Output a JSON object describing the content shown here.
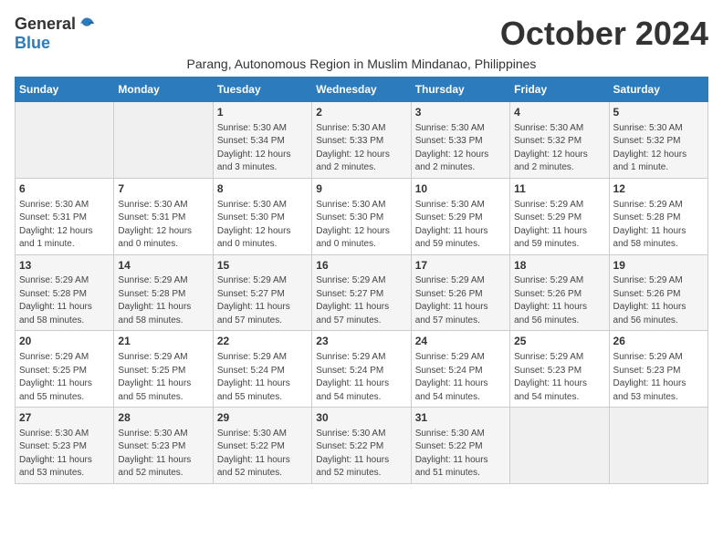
{
  "logo": {
    "general": "General",
    "blue": "Blue"
  },
  "header": {
    "month": "October 2024",
    "subtitle": "Parang, Autonomous Region in Muslim Mindanao, Philippines"
  },
  "weekdays": [
    "Sunday",
    "Monday",
    "Tuesday",
    "Wednesday",
    "Thursday",
    "Friday",
    "Saturday"
  ],
  "weeks": [
    [
      {
        "day": "",
        "info": ""
      },
      {
        "day": "",
        "info": ""
      },
      {
        "day": "1",
        "info": "Sunrise: 5:30 AM\nSunset: 5:34 PM\nDaylight: 12 hours\nand 3 minutes."
      },
      {
        "day": "2",
        "info": "Sunrise: 5:30 AM\nSunset: 5:33 PM\nDaylight: 12 hours\nand 2 minutes."
      },
      {
        "day": "3",
        "info": "Sunrise: 5:30 AM\nSunset: 5:33 PM\nDaylight: 12 hours\nand 2 minutes."
      },
      {
        "day": "4",
        "info": "Sunrise: 5:30 AM\nSunset: 5:32 PM\nDaylight: 12 hours\nand 2 minutes."
      },
      {
        "day": "5",
        "info": "Sunrise: 5:30 AM\nSunset: 5:32 PM\nDaylight: 12 hours\nand 1 minute."
      }
    ],
    [
      {
        "day": "6",
        "info": "Sunrise: 5:30 AM\nSunset: 5:31 PM\nDaylight: 12 hours\nand 1 minute."
      },
      {
        "day": "7",
        "info": "Sunrise: 5:30 AM\nSunset: 5:31 PM\nDaylight: 12 hours\nand 0 minutes."
      },
      {
        "day": "8",
        "info": "Sunrise: 5:30 AM\nSunset: 5:30 PM\nDaylight: 12 hours\nand 0 minutes."
      },
      {
        "day": "9",
        "info": "Sunrise: 5:30 AM\nSunset: 5:30 PM\nDaylight: 12 hours\nand 0 minutes."
      },
      {
        "day": "10",
        "info": "Sunrise: 5:30 AM\nSunset: 5:29 PM\nDaylight: 11 hours\nand 59 minutes."
      },
      {
        "day": "11",
        "info": "Sunrise: 5:29 AM\nSunset: 5:29 PM\nDaylight: 11 hours\nand 59 minutes."
      },
      {
        "day": "12",
        "info": "Sunrise: 5:29 AM\nSunset: 5:28 PM\nDaylight: 11 hours\nand 58 minutes."
      }
    ],
    [
      {
        "day": "13",
        "info": "Sunrise: 5:29 AM\nSunset: 5:28 PM\nDaylight: 11 hours\nand 58 minutes."
      },
      {
        "day": "14",
        "info": "Sunrise: 5:29 AM\nSunset: 5:28 PM\nDaylight: 11 hours\nand 58 minutes."
      },
      {
        "day": "15",
        "info": "Sunrise: 5:29 AM\nSunset: 5:27 PM\nDaylight: 11 hours\nand 57 minutes."
      },
      {
        "day": "16",
        "info": "Sunrise: 5:29 AM\nSunset: 5:27 PM\nDaylight: 11 hours\nand 57 minutes."
      },
      {
        "day": "17",
        "info": "Sunrise: 5:29 AM\nSunset: 5:26 PM\nDaylight: 11 hours\nand 57 minutes."
      },
      {
        "day": "18",
        "info": "Sunrise: 5:29 AM\nSunset: 5:26 PM\nDaylight: 11 hours\nand 56 minutes."
      },
      {
        "day": "19",
        "info": "Sunrise: 5:29 AM\nSunset: 5:26 PM\nDaylight: 11 hours\nand 56 minutes."
      }
    ],
    [
      {
        "day": "20",
        "info": "Sunrise: 5:29 AM\nSunset: 5:25 PM\nDaylight: 11 hours\nand 55 minutes."
      },
      {
        "day": "21",
        "info": "Sunrise: 5:29 AM\nSunset: 5:25 PM\nDaylight: 11 hours\nand 55 minutes."
      },
      {
        "day": "22",
        "info": "Sunrise: 5:29 AM\nSunset: 5:24 PM\nDaylight: 11 hours\nand 55 minutes."
      },
      {
        "day": "23",
        "info": "Sunrise: 5:29 AM\nSunset: 5:24 PM\nDaylight: 11 hours\nand 54 minutes."
      },
      {
        "day": "24",
        "info": "Sunrise: 5:29 AM\nSunset: 5:24 PM\nDaylight: 11 hours\nand 54 minutes."
      },
      {
        "day": "25",
        "info": "Sunrise: 5:29 AM\nSunset: 5:23 PM\nDaylight: 11 hours\nand 54 minutes."
      },
      {
        "day": "26",
        "info": "Sunrise: 5:29 AM\nSunset: 5:23 PM\nDaylight: 11 hours\nand 53 minutes."
      }
    ],
    [
      {
        "day": "27",
        "info": "Sunrise: 5:30 AM\nSunset: 5:23 PM\nDaylight: 11 hours\nand 53 minutes."
      },
      {
        "day": "28",
        "info": "Sunrise: 5:30 AM\nSunset: 5:23 PM\nDaylight: 11 hours\nand 52 minutes."
      },
      {
        "day": "29",
        "info": "Sunrise: 5:30 AM\nSunset: 5:22 PM\nDaylight: 11 hours\nand 52 minutes."
      },
      {
        "day": "30",
        "info": "Sunrise: 5:30 AM\nSunset: 5:22 PM\nDaylight: 11 hours\nand 52 minutes."
      },
      {
        "day": "31",
        "info": "Sunrise: 5:30 AM\nSunset: 5:22 PM\nDaylight: 11 hours\nand 51 minutes."
      },
      {
        "day": "",
        "info": ""
      },
      {
        "day": "",
        "info": ""
      }
    ]
  ]
}
